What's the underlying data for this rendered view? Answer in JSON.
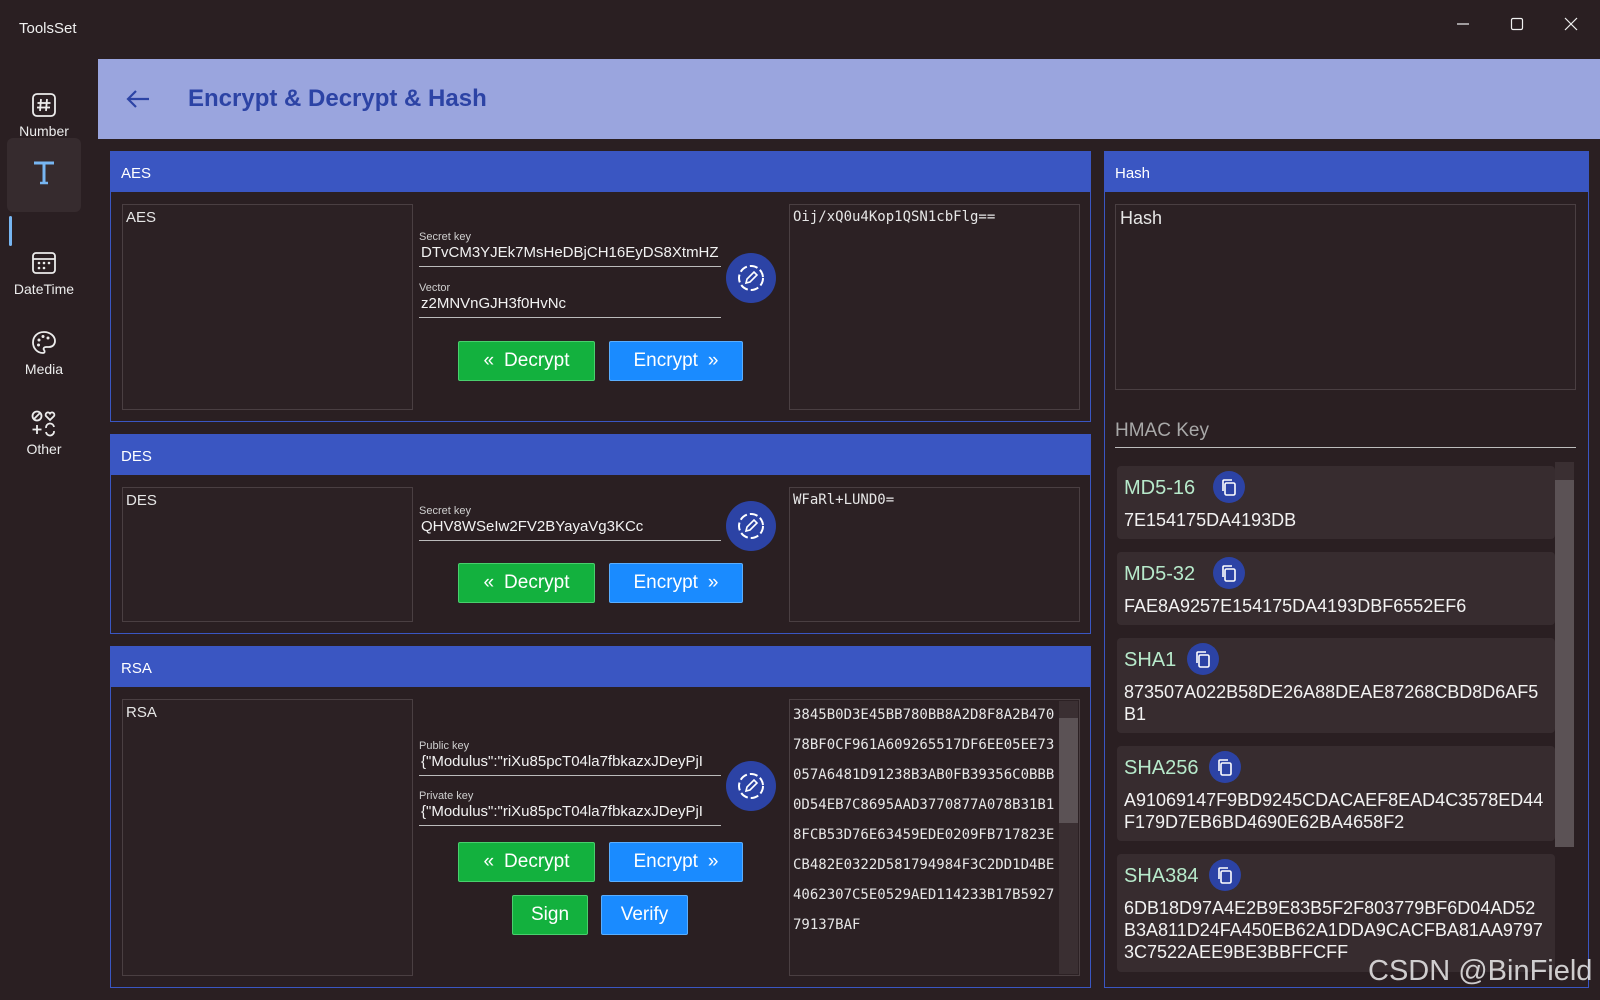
{
  "app": {
    "title": "ToolsSet"
  },
  "nav": {
    "items": [
      {
        "label": "Number",
        "icon": "hash-icon"
      },
      {
        "label": "",
        "icon": "text-icon",
        "active": true
      },
      {
        "label": "DateTime",
        "icon": "calendar-icon"
      },
      {
        "label": "Media",
        "icon": "palette-icon"
      },
      {
        "label": "Other",
        "icon": "shapes-icon"
      }
    ]
  },
  "header": {
    "title": "Encrypt & Decrypt & Hash"
  },
  "aes": {
    "title": "AES",
    "input": "AES",
    "secret_key_label": "Secret key",
    "secret_key": "DTvCM3YJEk7MsHeDBjCH16EyDS8XtmHZ",
    "vector_label": "Vector",
    "vector": "z2MNVnGJH3f0HvNc",
    "decrypt_label": "Decrypt",
    "encrypt_label": "Encrypt",
    "output": "Oij/xQ0u4Kop1QSN1cbFlg=="
  },
  "des": {
    "title": "DES",
    "input": "DES",
    "secret_key_label": "Secret key",
    "secret_key": "QHV8WSeIw2FV2BYayaVg3KCc",
    "decrypt_label": "Decrypt",
    "encrypt_label": "Encrypt",
    "output": "WFaRl+LUND0="
  },
  "rsa": {
    "title": "RSA",
    "input": "RSA",
    "public_key_label": "Public key",
    "public_key": "{\"Modulus\":\"riXu85pcT04la7fbkazxJDeyPjI",
    "private_key_label": "Private key",
    "private_key": "{\"Modulus\":\"riXu85pcT04la7fbkazxJDeyPjI",
    "decrypt_label": "Decrypt",
    "encrypt_label": "Encrypt",
    "sign_label": "Sign",
    "verify_label": "Verify",
    "output": "3845B0D3E45BB780BB8A2D8F8A2B47078BF0CF961A609265517DF6EE05EE73057A6481D91238B3AB0FB39356C0BBB0D54EB7C8695AAD3770877A078B31B18FCB53D76E63459EDE0209FB717823ECB482E0322D581794984F3C2DD1D4BE4062307C5E0529AED114233B17B592779137BAF"
  },
  "hash": {
    "title": "Hash",
    "input": "Hash",
    "hmac_placeholder": "HMAC Key",
    "results": [
      {
        "name": "MD5-16",
        "value": "7E154175DA4193DB"
      },
      {
        "name": "MD5-32",
        "value": "FAE8A9257E154175DA4193DBF6552EF6"
      },
      {
        "name": "SHA1",
        "value": "873507A022B58DE26A88DEAE87268CBD8D6AF5B1"
      },
      {
        "name": "SHA256",
        "value": "A91069147F9BD9245CDACAEF8EAD4C3578ED44F179D7EB6BD4690E62BA4658F2"
      },
      {
        "name": "SHA384",
        "value": "6DB18D97A4E2B9E83B5F2F803779BF6D04AD52B3A811D24FA450EB62A1DDA9CACFBA81AA97973C7522AEE9BE3BBFFCFF"
      }
    ]
  },
  "watermark": "CSDN @BinField",
  "colors": {
    "accent": "#3a56c2",
    "header_bg": "#9aa5de",
    "green": "#13b13e",
    "blue": "#1a8bff"
  }
}
